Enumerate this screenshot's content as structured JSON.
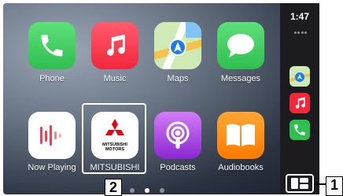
{
  "status": {
    "time": "1:47"
  },
  "apps": [
    {
      "id": "phone",
      "label": "Phone",
      "color": "#34c759",
      "icon": "phone-icon"
    },
    {
      "id": "music",
      "label": "Music",
      "color": "#fc3c44",
      "icon": "music-note-icon"
    },
    {
      "id": "maps",
      "label": "Maps",
      "color": "#7ed36f",
      "icon": "maps-icon"
    },
    {
      "id": "messages",
      "label": "Messages",
      "color": "#34c759",
      "icon": "message-bubble-icon"
    },
    {
      "id": "now-playing",
      "label": "Now Playing",
      "color": "#ffffff",
      "icon": "audio-bars-icon"
    },
    {
      "id": "mitsubishi",
      "label": "MITSUBISHI",
      "color": "#ffffff",
      "icon": "mitsubishi-logo",
      "logo_text": [
        "MITSUBISHI",
        "MOTORS"
      ]
    },
    {
      "id": "podcasts",
      "label": "Podcasts",
      "color": "#a33ee0",
      "icon": "podcasts-icon"
    },
    {
      "id": "audiobooks",
      "label": "Audiobooks",
      "color": "#ff8a00",
      "icon": "book-icon"
    }
  ],
  "recent_apps": [
    {
      "id": "maps",
      "icon": "maps-icon"
    },
    {
      "id": "music",
      "icon": "music-note-icon"
    },
    {
      "id": "phone",
      "icon": "phone-icon"
    }
  ],
  "dashboard_button": {
    "icon": "dashboard-icon"
  },
  "pagination": {
    "pages": 3,
    "current": 2
  },
  "callouts": {
    "dashboard": "1",
    "mitsubishi_app": "2"
  }
}
